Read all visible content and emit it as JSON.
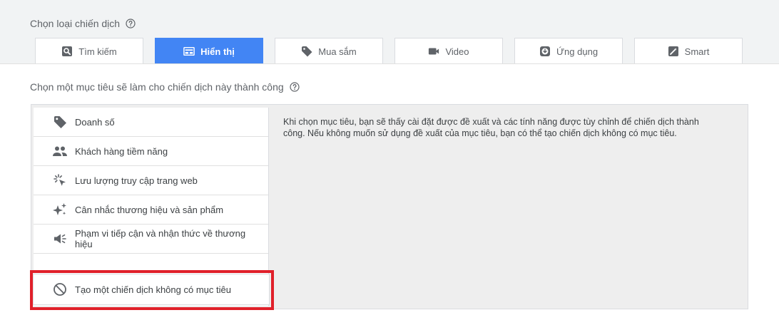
{
  "campaign_type": {
    "title": "Chọn loại chiến dịch",
    "tabs": [
      {
        "label": "Tìm kiếm",
        "icon": "search-icon",
        "active": false
      },
      {
        "label": "Hiển thị",
        "icon": "display-icon",
        "active": true
      },
      {
        "label": "Mua sắm",
        "icon": "tag-icon",
        "active": false
      },
      {
        "label": "Video",
        "icon": "video-icon",
        "active": false
      },
      {
        "label": "Ứng dụng",
        "icon": "app-download-icon",
        "active": false
      },
      {
        "label": "Smart",
        "icon": "magic-wand-icon",
        "active": false
      }
    ]
  },
  "goals": {
    "title": "Chọn một mục tiêu sẽ làm cho chiến dịch này thành công",
    "items": [
      {
        "label": "Doanh số",
        "icon": "tag-icon"
      },
      {
        "label": "Khách hàng tiềm năng",
        "icon": "people-icon"
      },
      {
        "label": "Lưu lượng truy cập trang web",
        "icon": "cursor-click-icon"
      },
      {
        "label": "Cân nhắc thương hiệu và sản phẩm",
        "icon": "sparkle-icon"
      },
      {
        "label": "Phạm vi tiếp cận và nhận thức về thương hiệu",
        "icon": "megaphone-icon"
      }
    ],
    "no_goal_label": "Tạo một chiến dịch không có mục tiêu",
    "description": "Khi chọn mục tiêu, bạn sẽ thấy cài đặt được đề xuất và các tính năng được tùy chỉnh để chiến dịch thành công. Nếu không muốn sử dụng đề xuất của mục tiêu, bạn có thể tạo chiến dịch không có mục tiêu."
  },
  "colors": {
    "active_tab": "#4285f4",
    "highlight": "#e0202a",
    "icon_gray": "#5f6368"
  }
}
